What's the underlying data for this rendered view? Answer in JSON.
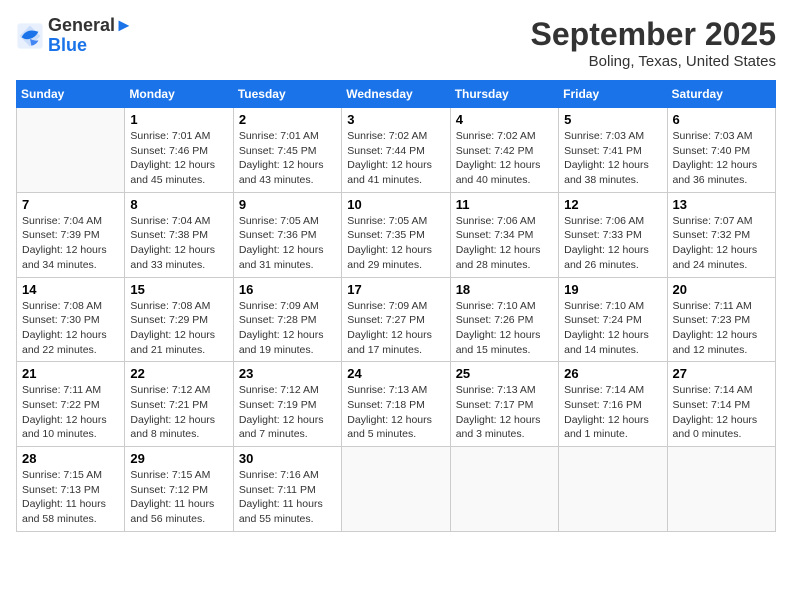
{
  "header": {
    "logo_line1": "General",
    "logo_line2": "Blue",
    "month": "September 2025",
    "location": "Boling, Texas, United States"
  },
  "weekdays": [
    "Sunday",
    "Monday",
    "Tuesday",
    "Wednesday",
    "Thursday",
    "Friday",
    "Saturday"
  ],
  "weeks": [
    [
      {
        "day": "",
        "sunrise": "",
        "sunset": "",
        "daylight": ""
      },
      {
        "day": "1",
        "sunrise": "7:01 AM",
        "sunset": "7:46 PM",
        "daylight": "12 hours and 45 minutes."
      },
      {
        "day": "2",
        "sunrise": "7:01 AM",
        "sunset": "7:45 PM",
        "daylight": "12 hours and 43 minutes."
      },
      {
        "day": "3",
        "sunrise": "7:02 AM",
        "sunset": "7:44 PM",
        "daylight": "12 hours and 41 minutes."
      },
      {
        "day": "4",
        "sunrise": "7:02 AM",
        "sunset": "7:42 PM",
        "daylight": "12 hours and 40 minutes."
      },
      {
        "day": "5",
        "sunrise": "7:03 AM",
        "sunset": "7:41 PM",
        "daylight": "12 hours and 38 minutes."
      },
      {
        "day": "6",
        "sunrise": "7:03 AM",
        "sunset": "7:40 PM",
        "daylight": "12 hours and 36 minutes."
      }
    ],
    [
      {
        "day": "7",
        "sunrise": "7:04 AM",
        "sunset": "7:39 PM",
        "daylight": "12 hours and 34 minutes."
      },
      {
        "day": "8",
        "sunrise": "7:04 AM",
        "sunset": "7:38 PM",
        "daylight": "12 hours and 33 minutes."
      },
      {
        "day": "9",
        "sunrise": "7:05 AM",
        "sunset": "7:36 PM",
        "daylight": "12 hours and 31 minutes."
      },
      {
        "day": "10",
        "sunrise": "7:05 AM",
        "sunset": "7:35 PM",
        "daylight": "12 hours and 29 minutes."
      },
      {
        "day": "11",
        "sunrise": "7:06 AM",
        "sunset": "7:34 PM",
        "daylight": "12 hours and 28 minutes."
      },
      {
        "day": "12",
        "sunrise": "7:06 AM",
        "sunset": "7:33 PM",
        "daylight": "12 hours and 26 minutes."
      },
      {
        "day": "13",
        "sunrise": "7:07 AM",
        "sunset": "7:32 PM",
        "daylight": "12 hours and 24 minutes."
      }
    ],
    [
      {
        "day": "14",
        "sunrise": "7:08 AM",
        "sunset": "7:30 PM",
        "daylight": "12 hours and 22 minutes."
      },
      {
        "day": "15",
        "sunrise": "7:08 AM",
        "sunset": "7:29 PM",
        "daylight": "12 hours and 21 minutes."
      },
      {
        "day": "16",
        "sunrise": "7:09 AM",
        "sunset": "7:28 PM",
        "daylight": "12 hours and 19 minutes."
      },
      {
        "day": "17",
        "sunrise": "7:09 AM",
        "sunset": "7:27 PM",
        "daylight": "12 hours and 17 minutes."
      },
      {
        "day": "18",
        "sunrise": "7:10 AM",
        "sunset": "7:26 PM",
        "daylight": "12 hours and 15 minutes."
      },
      {
        "day": "19",
        "sunrise": "7:10 AM",
        "sunset": "7:24 PM",
        "daylight": "12 hours and 14 minutes."
      },
      {
        "day": "20",
        "sunrise": "7:11 AM",
        "sunset": "7:23 PM",
        "daylight": "12 hours and 12 minutes."
      }
    ],
    [
      {
        "day": "21",
        "sunrise": "7:11 AM",
        "sunset": "7:22 PM",
        "daylight": "12 hours and 10 minutes."
      },
      {
        "day": "22",
        "sunrise": "7:12 AM",
        "sunset": "7:21 PM",
        "daylight": "12 hours and 8 minutes."
      },
      {
        "day": "23",
        "sunrise": "7:12 AM",
        "sunset": "7:19 PM",
        "daylight": "12 hours and 7 minutes."
      },
      {
        "day": "24",
        "sunrise": "7:13 AM",
        "sunset": "7:18 PM",
        "daylight": "12 hours and 5 minutes."
      },
      {
        "day": "25",
        "sunrise": "7:13 AM",
        "sunset": "7:17 PM",
        "daylight": "12 hours and 3 minutes."
      },
      {
        "day": "26",
        "sunrise": "7:14 AM",
        "sunset": "7:16 PM",
        "daylight": "12 hours and 1 minute."
      },
      {
        "day": "27",
        "sunrise": "7:14 AM",
        "sunset": "7:14 PM",
        "daylight": "12 hours and 0 minutes."
      }
    ],
    [
      {
        "day": "28",
        "sunrise": "7:15 AM",
        "sunset": "7:13 PM",
        "daylight": "11 hours and 58 minutes."
      },
      {
        "day": "29",
        "sunrise": "7:15 AM",
        "sunset": "7:12 PM",
        "daylight": "11 hours and 56 minutes."
      },
      {
        "day": "30",
        "sunrise": "7:16 AM",
        "sunset": "7:11 PM",
        "daylight": "11 hours and 55 minutes."
      },
      {
        "day": "",
        "sunrise": "",
        "sunset": "",
        "daylight": ""
      },
      {
        "day": "",
        "sunrise": "",
        "sunset": "",
        "daylight": ""
      },
      {
        "day": "",
        "sunrise": "",
        "sunset": "",
        "daylight": ""
      },
      {
        "day": "",
        "sunrise": "",
        "sunset": "",
        "daylight": ""
      }
    ]
  ],
  "labels": {
    "sunrise_prefix": "Sunrise: ",
    "sunset_prefix": "Sunset: ",
    "daylight_prefix": "Daylight: "
  }
}
